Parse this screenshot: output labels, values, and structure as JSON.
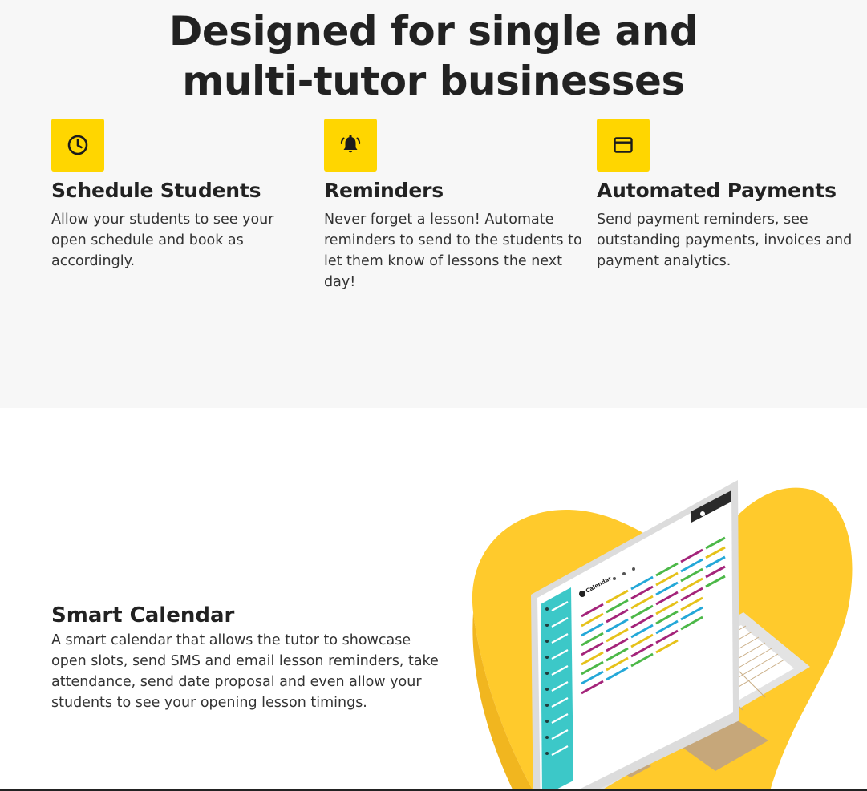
{
  "features": {
    "title_lines": [
      "Designed for single and",
      "multi-tutor businesses"
    ],
    "cards": [
      {
        "icon": "clock-icon",
        "title": "Schedule Students",
        "lines": [
          "Allow your students to see your",
          "open schedule and book as",
          "accordingly."
        ]
      },
      {
        "icon": "bell-icon",
        "title": "Reminders",
        "lines": [
          "Never forget a lesson! Automate",
          "reminders to send to the students to",
          "let them know of lessons the next",
          "day!"
        ]
      },
      {
        "icon": "credit-card-icon",
        "title": "Automated Payments",
        "lines": [
          "Send payment reminders, see",
          "outstanding payments, invoices and",
          "payment analytics."
        ]
      }
    ]
  },
  "calendar": {
    "title": "Smart Calendar",
    "lines": [
      "A smart calendar that allows the tutor to showcase",
      "open slots, send SMS and email lesson reminders, take",
      "attendance, send date proposal and even allow your",
      "students to see your opening lesson timings."
    ],
    "screen_title": "Calendar"
  },
  "colors": {
    "accent_yellow": "#ffd600",
    "blob_yellow": "#ffca2c",
    "sidebar_teal": "#3cc8c8",
    "event_colors": [
      "#e6c21a",
      "#a4247a",
      "#24a8d8",
      "#4cb848"
    ]
  }
}
